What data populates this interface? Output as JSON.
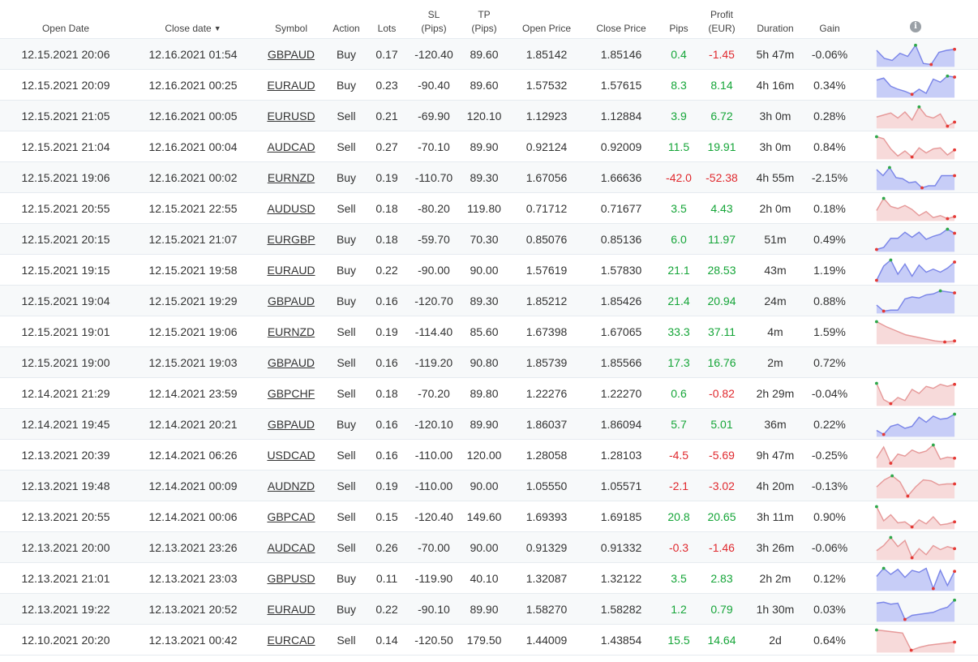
{
  "header": {
    "open_date": "Open Date",
    "close_date": "Close date",
    "sort_icon": "sort-desc-icon",
    "symbol": "Symbol",
    "action": "Action",
    "lots": "Lots",
    "sl_line1": "SL",
    "sl_line2": "(Pips)",
    "tp_line1": "TP",
    "tp_line2": "(Pips)",
    "open_price": "Open Price",
    "close_price": "Close Price",
    "pips": "Pips",
    "profit_line1": "Profit",
    "profit_line2": "(EUR)",
    "duration": "Duration",
    "gain": "Gain",
    "info_icon": "info-icon"
  },
  "colors": {
    "positive": "#15a538",
    "negative": "#e0292e",
    "buy_line": "#7b86e8",
    "buy_fill": "#c7cdf7",
    "sell_line": "#e69a9a",
    "sell_fill": "#f7dada",
    "marker_high": "#2ea84a",
    "marker_low": "#e53935"
  },
  "rows": [
    {
      "open": "12.15.2021 20:06",
      "close": "12.16.2021 01:54",
      "symbol": "GBPAUD",
      "action": "Buy",
      "lots": "0.17",
      "sl": "-120.40",
      "tp": "89.60",
      "open_price": "1.85142",
      "close_price": "1.85146",
      "pips": "0.4",
      "profit": "-1.45",
      "duration": "5h 47m",
      "gain": "-0.06%",
      "pips_sign": "pos",
      "profit_sign": "neg",
      "spark": [
        0.7,
        0.3,
        0.2,
        0.55,
        0.4,
        0.95,
        0.05,
        0.0,
        0.6,
        0.7,
        0.75
      ]
    },
    {
      "open": "12.15.2021 20:09",
      "close": "12.16.2021 00:25",
      "symbol": "EURAUD",
      "action": "Buy",
      "lots": "0.23",
      "sl": "-90.40",
      "tp": "89.60",
      "open_price": "1.57532",
      "close_price": "1.57615",
      "pips": "8.3",
      "profit": "8.14",
      "duration": "4h 16m",
      "gain": "0.34%",
      "pips_sign": "pos",
      "profit_sign": "pos",
      "spark": [
        0.75,
        0.85,
        0.45,
        0.3,
        0.2,
        0.05,
        0.3,
        0.1,
        0.8,
        0.65,
        0.95,
        0.9
      ]
    },
    {
      "open": "12.15.2021 21:05",
      "close": "12.16.2021 00:05",
      "symbol": "EURUSD",
      "action": "Sell",
      "lots": "0.21",
      "sl": "-69.90",
      "tp": "120.10",
      "open_price": "1.12923",
      "close_price": "1.12884",
      "pips": "3.9",
      "profit": "6.72",
      "duration": "3h 0m",
      "gain": "0.28%",
      "pips_sign": "pos",
      "profit_sign": "pos",
      "spark": [
        0.45,
        0.55,
        0.65,
        0.4,
        0.7,
        0.3,
        0.95,
        0.5,
        0.4,
        0.6,
        0.0,
        0.2
      ]
    },
    {
      "open": "12.15.2021 21:04",
      "close": "12.16.2021 00:04",
      "symbol": "AUDCAD",
      "action": "Sell",
      "lots": "0.27",
      "sl": "-70.10",
      "tp": "89.90",
      "open_price": "0.92124",
      "close_price": "0.92009",
      "pips": "11.5",
      "profit": "19.91",
      "duration": "3h 0m",
      "gain": "0.84%",
      "pips_sign": "pos",
      "profit_sign": "pos",
      "spark": [
        1.0,
        0.9,
        0.4,
        0.05,
        0.3,
        0.0,
        0.45,
        0.2,
        0.4,
        0.45,
        0.1,
        0.35
      ]
    },
    {
      "open": "12.15.2021 19:06",
      "close": "12.16.2021 00:02",
      "symbol": "EURNZD",
      "action": "Buy",
      "lots": "0.19",
      "sl": "-110.70",
      "tp": "89.30",
      "open_price": "1.67056",
      "close_price": "1.66636",
      "pips": "-42.0",
      "profit": "-52.38",
      "duration": "4h 55m",
      "gain": "-2.15%",
      "pips_sign": "neg",
      "profit_sign": "neg",
      "spark": [
        0.9,
        0.6,
        1.0,
        0.5,
        0.45,
        0.25,
        0.3,
        0.0,
        0.1,
        0.1,
        0.6,
        0.6,
        0.6
      ]
    },
    {
      "open": "12.15.2021 20:55",
      "close": "12.15.2021 22:55",
      "symbol": "AUDUSD",
      "action": "Sell",
      "lots": "0.18",
      "sl": "-80.20",
      "tp": "119.80",
      "open_price": "0.71712",
      "close_price": "0.71677",
      "pips": "3.5",
      "profit": "4.43",
      "duration": "2h 0m",
      "gain": "0.18%",
      "pips_sign": "pos",
      "profit_sign": "pos",
      "spark": [
        0.4,
        1.0,
        0.6,
        0.5,
        0.65,
        0.45,
        0.15,
        0.35,
        0.05,
        0.15,
        0.0,
        0.1
      ]
    },
    {
      "open": "12.15.2021 20:15",
      "close": "12.15.2021 21:07",
      "symbol": "EURGBP",
      "action": "Buy",
      "lots": "0.18",
      "sl": "-59.70",
      "tp": "70.30",
      "open_price": "0.85076",
      "close_price": "0.85136",
      "pips": "6.0",
      "profit": "11.97",
      "duration": "51m",
      "gain": "0.49%",
      "pips_sign": "pos",
      "profit_sign": "pos",
      "spark": [
        0.0,
        0.1,
        0.55,
        0.55,
        0.85,
        0.6,
        0.85,
        0.5,
        0.65,
        0.75,
        1.0,
        0.8
      ]
    },
    {
      "open": "12.15.2021 19:15",
      "close": "12.15.2021 19:58",
      "symbol": "EURAUD",
      "action": "Buy",
      "lots": "0.22",
      "sl": "-90.00",
      "tp": "90.00",
      "open_price": "1.57619",
      "close_price": "1.57830",
      "pips": "21.1",
      "profit": "28.53",
      "duration": "43m",
      "gain": "1.19%",
      "pips_sign": "pos",
      "profit_sign": "pos",
      "spark": [
        0.0,
        0.7,
        1.0,
        0.3,
        0.8,
        0.2,
        0.75,
        0.4,
        0.55,
        0.4,
        0.6,
        0.9
      ]
    },
    {
      "open": "12.15.2021 19:04",
      "close": "12.15.2021 19:29",
      "symbol": "GBPAUD",
      "action": "Buy",
      "lots": "0.16",
      "sl": "-120.70",
      "tp": "89.30",
      "open_price": "1.85212",
      "close_price": "1.85426",
      "pips": "21.4",
      "profit": "20.94",
      "duration": "24m",
      "gain": "0.88%",
      "pips_sign": "pos",
      "profit_sign": "pos",
      "spark": [
        0.3,
        0.0,
        0.05,
        0.05,
        0.6,
        0.7,
        0.65,
        0.8,
        0.85,
        1.0,
        0.95,
        0.9
      ]
    },
    {
      "open": "12.15.2021 19:01",
      "close": "12.15.2021 19:06",
      "symbol": "EURNZD",
      "action": "Sell",
      "lots": "0.19",
      "sl": "-114.40",
      "tp": "85.60",
      "open_price": "1.67398",
      "close_price": "1.67065",
      "pips": "33.3",
      "profit": "37.11",
      "duration": "4m",
      "gain": "1.59%",
      "pips_sign": "pos",
      "profit_sign": "pos",
      "spark": [
        1.0,
        0.75,
        0.55,
        0.35,
        0.25,
        0.15,
        0.05,
        0.0,
        0.05
      ]
    },
    {
      "open": "12.15.2021 19:00",
      "close": "12.15.2021 19:03",
      "symbol": "GBPAUD",
      "action": "Sell",
      "lots": "0.16",
      "sl": "-119.20",
      "tp": "90.80",
      "open_price": "1.85739",
      "close_price": "1.85566",
      "pips": "17.3",
      "profit": "16.76",
      "duration": "2m",
      "gain": "0.72%",
      "pips_sign": "pos",
      "profit_sign": "pos",
      "spark": []
    },
    {
      "open": "12.14.2021 21:29",
      "close": "12.14.2021 23:59",
      "symbol": "GBPCHF",
      "action": "Sell",
      "lots": "0.18",
      "sl": "-70.20",
      "tp": "89.80",
      "open_price": "1.22276",
      "close_price": "1.22270",
      "pips": "0.6",
      "profit": "-0.82",
      "duration": "2h 29m",
      "gain": "-0.04%",
      "pips_sign": "pos",
      "profit_sign": "neg",
      "spark": [
        1.0,
        0.2,
        0.0,
        0.3,
        0.15,
        0.7,
        0.5,
        0.85,
        0.75,
        0.95,
        0.85,
        0.95
      ]
    },
    {
      "open": "12.14.2021 19:45",
      "close": "12.14.2021 20:21",
      "symbol": "GBPAUD",
      "action": "Buy",
      "lots": "0.16",
      "sl": "-120.10",
      "tp": "89.90",
      "open_price": "1.86037",
      "close_price": "1.86094",
      "pips": "5.7",
      "profit": "5.01",
      "duration": "36m",
      "gain": "0.22%",
      "pips_sign": "pos",
      "profit_sign": "pos",
      "spark": [
        0.2,
        0.0,
        0.4,
        0.5,
        0.3,
        0.4,
        0.85,
        0.6,
        0.9,
        0.75,
        0.8,
        1.0
      ]
    },
    {
      "open": "12.13.2021 20:39",
      "close": "12.14.2021 06:26",
      "symbol": "USDCAD",
      "action": "Sell",
      "lots": "0.16",
      "sl": "-110.00",
      "tp": "120.00",
      "open_price": "1.28058",
      "close_price": "1.28103",
      "pips": "-4.5",
      "profit": "-5.69",
      "duration": "9h 47m",
      "gain": "-0.25%",
      "pips_sign": "neg",
      "profit_sign": "neg",
      "spark": [
        0.35,
        0.9,
        0.1,
        0.55,
        0.45,
        0.75,
        0.6,
        0.7,
        1.0,
        0.3,
        0.4,
        0.35
      ]
    },
    {
      "open": "12.13.2021 19:48",
      "close": "12.14.2021 00:09",
      "symbol": "AUDNZD",
      "action": "Sell",
      "lots": "0.19",
      "sl": "-110.00",
      "tp": "90.00",
      "open_price": "1.05550",
      "close_price": "1.05571",
      "pips": "-2.1",
      "profit": "-3.02",
      "duration": "4h 20m",
      "gain": "-0.13%",
      "pips_sign": "neg",
      "profit_sign": "neg",
      "spark": [
        0.45,
        0.8,
        1.0,
        0.7,
        0.0,
        0.45,
        0.8,
        0.75,
        0.55,
        0.6,
        0.6
      ]
    },
    {
      "open": "12.13.2021 20:55",
      "close": "12.14.2021 00:06",
      "symbol": "GBPCAD",
      "action": "Sell",
      "lots": "0.15",
      "sl": "-120.40",
      "tp": "149.60",
      "open_price": "1.69393",
      "close_price": "1.69185",
      "pips": "20.8",
      "profit": "20.65",
      "duration": "3h 11m",
      "gain": "0.90%",
      "pips_sign": "pos",
      "profit_sign": "pos",
      "spark": [
        1.0,
        0.3,
        0.6,
        0.2,
        0.25,
        0.0,
        0.35,
        0.15,
        0.5,
        0.1,
        0.15,
        0.25
      ]
    },
    {
      "open": "12.13.2021 20:00",
      "close": "12.13.2021 23:26",
      "symbol": "AUDCAD",
      "action": "Sell",
      "lots": "0.26",
      "sl": "-70.00",
      "tp": "90.00",
      "open_price": "0.91329",
      "close_price": "0.91332",
      "pips": "-0.3",
      "profit": "-1.46",
      "duration": "3h 26m",
      "gain": "-0.06%",
      "pips_sign": "neg",
      "profit_sign": "neg",
      "spark": [
        0.35,
        0.6,
        1.0,
        0.55,
        0.85,
        0.0,
        0.45,
        0.15,
        0.6,
        0.4,
        0.55,
        0.45
      ]
    },
    {
      "open": "12.13.2021 21:01",
      "close": "12.13.2021 23:03",
      "symbol": "GBPUSD",
      "action": "Buy",
      "lots": "0.11",
      "sl": "-119.90",
      "tp": "40.10",
      "open_price": "1.32087",
      "close_price": "1.32122",
      "pips": "3.5",
      "profit": "2.83",
      "duration": "2h 2m",
      "gain": "0.12%",
      "pips_sign": "pos",
      "profit_sign": "pos",
      "spark": [
        0.6,
        1.0,
        0.7,
        0.95,
        0.55,
        0.9,
        0.8,
        1.0,
        0.0,
        0.9,
        0.15,
        0.85
      ]
    },
    {
      "open": "12.13.2021 19:22",
      "close": "12.13.2021 20:52",
      "symbol": "EURAUD",
      "action": "Buy",
      "lots": "0.22",
      "sl": "-90.10",
      "tp": "89.90",
      "open_price": "1.58270",
      "close_price": "1.58282",
      "pips": "1.2",
      "profit": "0.79",
      "duration": "1h 30m",
      "gain": "0.03%",
      "pips_sign": "pos",
      "profit_sign": "pos",
      "spark": [
        0.8,
        0.85,
        0.75,
        0.8,
        0.0,
        0.2,
        0.25,
        0.3,
        0.35,
        0.5,
        0.6,
        0.95
      ]
    },
    {
      "open": "12.10.2021 20:20",
      "close": "12.13.2021 00:42",
      "symbol": "EURCAD",
      "action": "Sell",
      "lots": "0.14",
      "sl": "-120.50",
      "tp": "179.50",
      "open_price": "1.44009",
      "close_price": "1.43854",
      "pips": "15.5",
      "profit": "14.64",
      "duration": "2d",
      "gain": "0.64%",
      "pips_sign": "pos",
      "profit_sign": "pos",
      "spark": [
        1.0,
        0.95,
        0.9,
        0.85,
        0.0,
        0.15,
        0.25,
        0.3,
        0.35,
        0.4
      ]
    }
  ]
}
